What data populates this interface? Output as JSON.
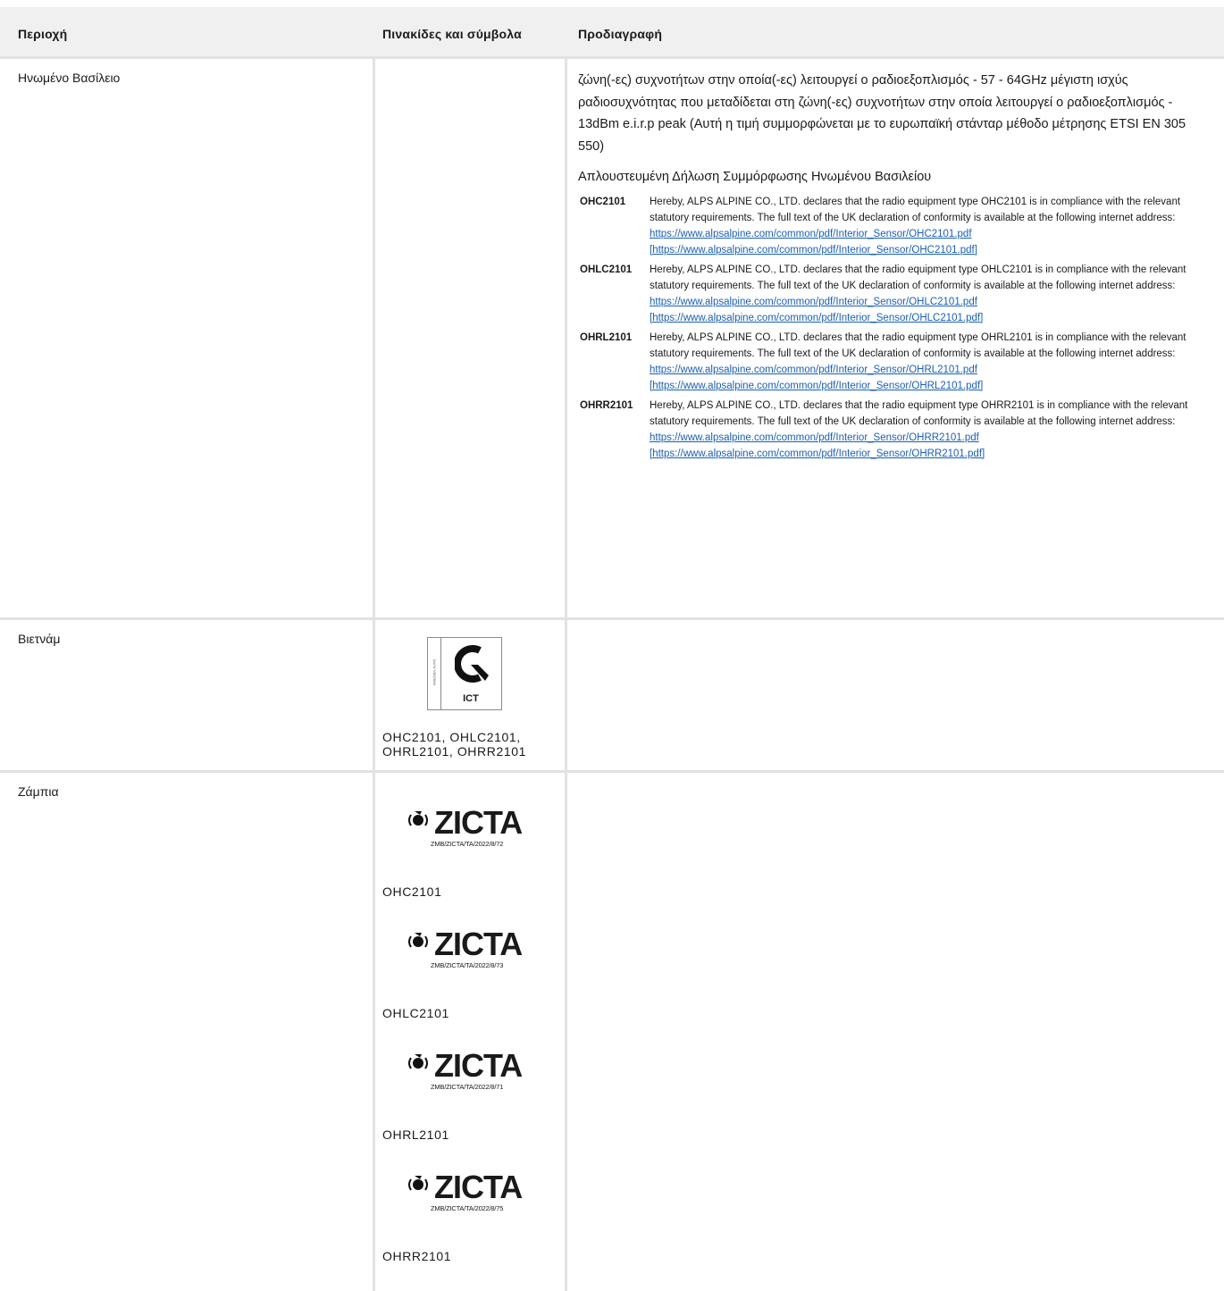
{
  "header": {
    "region": "Περιοχή",
    "marks": "Πινακίδες και σύμβολα",
    "spec": "Προδιαγραφή"
  },
  "uk": {
    "region": "Ηνωμένο Βασίλειο",
    "spec_p1": "ζώνη(-ες) συχνοτήτων στην οποία(-ες) λειτουργεί ο ραδιοεξοπλισμός - 57 - 64GHz μέγιστη ισχύς ραδιοσυχνότητας που μεταδίδεται στη ζώνη(-ες) συχνοτήτων στην οποία λειτουργεί ο ραδιοεξοπλισμός - 13dBm e.i.r.p peak (Αυτή η τιμή συμμορφώνεται με το ευρωπαϊκή στάνταρ μέθοδο μέτρησης ETSI EN 305 550)",
    "spec_p2": "Απλουστευμένη Δήλωση Συμμόρφωσης Ηνωμένου Βασιλείου",
    "declarations": [
      {
        "model": "OHC2101",
        "text": "Hereby, ALPS ALPINE CO., LTD. declares that the radio equipment type OHC2101 is in compliance with the relevant statutory requirements.  The full text of the UK declaration of conformity is available at the following internet address: ",
        "link": "https://www.alpsalpine.com/common/pdf/Interior_Sensor/OHC2101.pdf [https://www.alpsalpine.com/common/pdf/Interior_Sensor/OHC2101.pdf]"
      },
      {
        "model": "OHLC2101",
        "text": "Hereby, ALPS ALPINE CO., LTD. declares that the radio equipment type OHLC2101 is in compliance with the relevant statutory requirements.  The full text of the UK declaration of conformity is available at the following internet address: ",
        "link": "https://www.alpsalpine.com/common/pdf/Interior_Sensor/OHLC2101.pdf [https://www.alpsalpine.com/common/pdf/Interior_Sensor/OHLC2101.pdf]"
      },
      {
        "model": "OHRL2101",
        "text": "Hereby, ALPS ALPINE CO., LTD. declares that the radio equipment type OHRL2101 is in compliance with the relevant statutory requirements.  The full text of the UK declaration of conformity is available at the following internet address: ",
        "link": "https://www.alpsalpine.com/common/pdf/Interior_Sensor/OHRL2101.pdf [https://www.alpsalpine.com/common/pdf/Interior_Sensor/OHRL2101.pdf]"
      },
      {
        "model": "OHRR2101",
        "text": "Hereby, ALPS ALPINE CO., LTD. declares that the radio equipment type OHRR2101 is in compliance with the relevant statutory requirements.  The full text of the UK declaration of conformity is available at the following internet address: ",
        "link": "https://www.alpsalpine.com/common/pdf/Interior_Sensor/OHRR2101.pdf [https://www.alpsalpine.com/common/pdf/Interior_Sensor/OHRR2101.pdf]"
      }
    ]
  },
  "vietnam": {
    "region": "Βιετνάμ",
    "logo_side_text": "SWEDEN AUTO",
    "logo_label": "ICT",
    "models": "OHC2101, OHLC2101, OHRL2101, OHRR2101"
  },
  "zambia": {
    "region": "Ζάμπια",
    "logo_word": "ZICTA",
    "items": [
      {
        "approval": "ZMB/ZICTA/TA/2022/8/72",
        "model": "OHC2101"
      },
      {
        "approval": "ZMB/ZICTA/TA/2022/8/73",
        "model": "OHLC2101"
      },
      {
        "approval": "ZMB/ZICTA/TA/2022/8/71",
        "model": "OHRL2101"
      },
      {
        "approval": "ZMB/ZICTA/TA/2022/8/75",
        "model": "OHRR2101"
      }
    ]
  }
}
